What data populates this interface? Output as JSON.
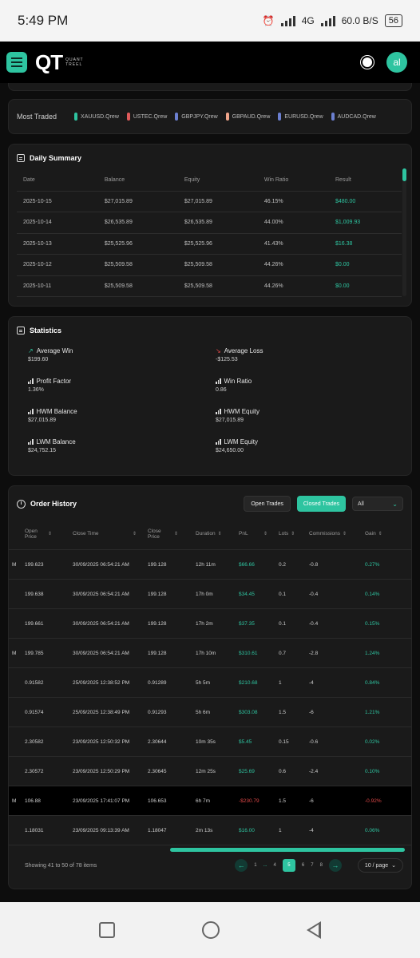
{
  "status_bar": {
    "time": "5:49 PM",
    "network": "4G",
    "speed": "60.0",
    "speed_unit": "B/S",
    "battery": "56"
  },
  "header": {
    "logo_mark": "QT",
    "logo_sub_1": "QUANT",
    "logo_sub_2": "TREEL",
    "avatar": "al"
  },
  "most_traded": {
    "label": "Most Traded",
    "items": [
      {
        "name": "XAUUSD.Qrew",
        "color": "#2ec4a0"
      },
      {
        "name": "USTEC.Qrew",
        "color": "#e05a5a"
      },
      {
        "name": "GBPJPY.Qrew",
        "color": "#6b7fd0"
      },
      {
        "name": "GBPAUD.Qrew",
        "color": "#f0a48a"
      },
      {
        "name": "EURUSD.Qrew",
        "color": "#6b7fd0"
      },
      {
        "name": "AUDCAD.Qrew",
        "color": "#6b7fd0"
      }
    ]
  },
  "daily_summary": {
    "title": "Daily Summary",
    "columns": [
      "Date",
      "Balance",
      "Equity",
      "Win Ratio",
      "Result"
    ],
    "rows": [
      [
        "2025-10-15",
        "$27,015.89",
        "$27,015.89",
        "46.15%",
        "$480.00"
      ],
      [
        "2025-10-14",
        "$26,535.89",
        "$26,535.89",
        "44.00%",
        "$1,009.93"
      ],
      [
        "2025-10-13",
        "$25,525.96",
        "$25,525.96",
        "41.43%",
        "$16.38"
      ],
      [
        "2025-10-12",
        "$25,509.58",
        "$25,509.58",
        "44.26%",
        "$0.00"
      ],
      [
        "2025-10-11",
        "$25,509.58",
        "$25,509.58",
        "44.26%",
        "$0.00"
      ]
    ]
  },
  "statistics": {
    "title": "Statistics",
    "items": [
      {
        "label": "Average Win",
        "value": "$199.60",
        "icon": "trend-up-icon"
      },
      {
        "label": "Average Loss",
        "value": "-$125.53",
        "icon": "trend-down-icon"
      },
      {
        "label": "Profit Factor",
        "value": "1.36%",
        "icon": "bar-chart-icon"
      },
      {
        "label": "Win Ratio",
        "value": "0.86",
        "icon": "bar-chart-icon"
      },
      {
        "label": "HWM Balance",
        "value": "$27,015.89",
        "icon": "bar-chart-icon"
      },
      {
        "label": "HWM Equity",
        "value": "$27,015.89",
        "icon": "bar-chart-icon"
      },
      {
        "label": "LWM Balance",
        "value": "$24,752.15",
        "icon": "bar-chart-icon"
      },
      {
        "label": "LWM Equity",
        "value": "$24,650.00",
        "icon": "bar-chart-icon"
      }
    ]
  },
  "order_history": {
    "title": "Order History",
    "open_trades": "Open Trades",
    "closed_trades": "Closed Trades",
    "filter": "All",
    "columns": [
      "Open Price",
      "Close Time",
      "Close Price",
      "Duration",
      "PnL",
      "Lots",
      "Commissions",
      "Gain"
    ],
    "rows": [
      {
        "cut": "M",
        "open": "199.623",
        "close_time": "30/09/2025 06:54:21 AM",
        "close_price": "199.128",
        "duration": "12h 11m",
        "pnl": "$66.66",
        "lots": "0.2",
        "comm": "-0.8",
        "gain": "0.27%",
        "sign": "pos"
      },
      {
        "cut": "",
        "open": "199.638",
        "close_time": "30/09/2025 06:54:21 AM",
        "close_price": "199.128",
        "duration": "17h 0m",
        "pnl": "$34.45",
        "lots": "0.1",
        "comm": "-0.4",
        "gain": "0.14%",
        "sign": "pos"
      },
      {
        "cut": "",
        "open": "199.661",
        "close_time": "30/09/2025 06:54:21 AM",
        "close_price": "199.128",
        "duration": "17h 2m",
        "pnl": "$37.35",
        "lots": "0.1",
        "comm": "-0.4",
        "gain": "0.15%",
        "sign": "pos"
      },
      {
        "cut": "M",
        "open": "199.785",
        "close_time": "30/09/2025 06:54:21 AM",
        "close_price": "199.128",
        "duration": "17h 10m",
        "pnl": "$310.61",
        "lots": "0.7",
        "comm": "-2.8",
        "gain": "1.24%",
        "sign": "pos"
      },
      {
        "cut": "",
        "open": "0.91582",
        "close_time": "25/09/2025 12:38:52 PM",
        "close_price": "0.91289",
        "duration": "5h 5m",
        "pnl": "$210.68",
        "lots": "1",
        "comm": "-4",
        "gain": "0.84%",
        "sign": "pos"
      },
      {
        "cut": "",
        "open": "0.91574",
        "close_time": "25/09/2025 12:38:49 PM",
        "close_price": "0.91293",
        "duration": "5h 6m",
        "pnl": "$303.08",
        "lots": "1.5",
        "comm": "-6",
        "gain": "1.21%",
        "sign": "pos"
      },
      {
        "cut": "",
        "open": "2.30582",
        "close_time": "23/09/2025 12:50:32 PM",
        "close_price": "2.30644",
        "duration": "10m 35s",
        "pnl": "$5.45",
        "lots": "0.15",
        "comm": "-0.6",
        "gain": "0.02%",
        "sign": "pos"
      },
      {
        "cut": "",
        "open": "2.30572",
        "close_time": "23/09/2025 12:50:29 PM",
        "close_price": "2.30645",
        "duration": "12m 25s",
        "pnl": "$25.69",
        "lots": "0.6",
        "comm": "-2.4",
        "gain": "0.10%",
        "sign": "pos"
      },
      {
        "cut": "M",
        "open": "106.88",
        "close_time": "23/09/2025 17:41:07 PM",
        "close_price": "106.653",
        "duration": "6h 7m",
        "pnl": "-$230.79",
        "lots": "1.5",
        "comm": "-6",
        "gain": "-0.92%",
        "sign": "neg"
      },
      {
        "cut": "",
        "open": "1.18031",
        "close_time": "23/09/2025 09:13:39 AM",
        "close_price": "1.18047",
        "duration": "2m 13s",
        "pnl": "$16.00",
        "lots": "1",
        "comm": "-4",
        "gain": "0.06%",
        "sign": "pos"
      }
    ],
    "showing": "Showing 41 to 50 of 78 items",
    "pages": [
      "1",
      "...",
      "4",
      "5",
      "6",
      "7",
      "8"
    ],
    "current_page": "5",
    "per_page": "10 / page"
  }
}
